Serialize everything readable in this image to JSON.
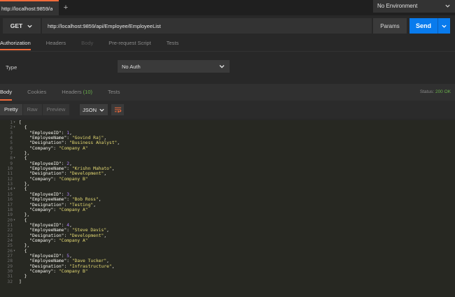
{
  "tabs": {
    "active_tab": "http://localhost:9859/a",
    "add_tab": "+"
  },
  "environment": {
    "selected": "No Environment"
  },
  "request": {
    "method": "GET",
    "url": "http://localhost:9859/api/Employee/EmployeeList",
    "params_label": "Params",
    "send_label": "Send"
  },
  "request_tabs": [
    {
      "label": "Authorization",
      "state": "active"
    },
    {
      "label": "Headers",
      "state": "normal"
    },
    {
      "label": "Body",
      "state": "disabled"
    },
    {
      "label": "Pre-request Script",
      "state": "normal"
    },
    {
      "label": "Tests",
      "state": "normal"
    }
  ],
  "auth": {
    "type_label": "Type",
    "type_value": "No Auth"
  },
  "response_tabs": {
    "body": "Body",
    "cookies": "Cookies",
    "headers": "Headers",
    "headers_count": "(10)",
    "tests": "Tests"
  },
  "status": {
    "label": "Status:",
    "value": "200 OK"
  },
  "view_modes": {
    "pretty": "Pretty",
    "raw": "Raw",
    "preview": "Preview"
  },
  "format": {
    "selected": "JSON"
  },
  "colors": {
    "accent": "#f26b3a",
    "send": "#097bed",
    "status_ok": "#6ab04c",
    "string": "#e6db74",
    "number": "#ae81ff"
  },
  "employees": [
    {
      "EmployeeID": 1,
      "EmployeeName": "Govind Raj",
      "Designation": "Business Analyst",
      "Company": "Company A"
    },
    {
      "EmployeeID": 2,
      "EmployeeName": "Krishn Mahato",
      "Designation": "Development",
      "Company": "Company B"
    },
    {
      "EmployeeID": 3,
      "EmployeeName": "Bob Ross",
      "Designation": "Testing",
      "Company": "Company A"
    },
    {
      "EmployeeID": 4,
      "EmployeeName": "Steve Davis",
      "Designation": "Development",
      "Company": "Company A"
    },
    {
      "EmployeeID": 5,
      "EmployeeName": "Dave Tucker",
      "Designation": "Infrastructure",
      "Company": "Company B"
    }
  ]
}
